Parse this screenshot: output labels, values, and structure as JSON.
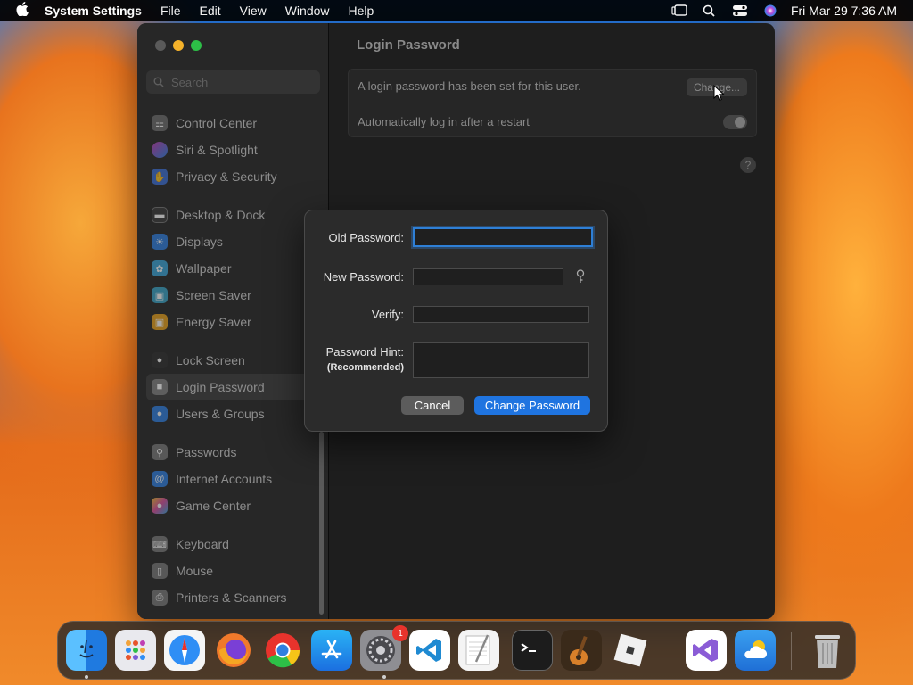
{
  "menubar": {
    "app_name": "System Settings",
    "menus": [
      "File",
      "Edit",
      "View",
      "Window",
      "Help"
    ],
    "clock": "Fri Mar 29  7:36 AM"
  },
  "sidebar": {
    "search_placeholder": "Search",
    "items": [
      {
        "label": "Control Center",
        "icon": "control-center-icon",
        "color": "#7a7a7a"
      },
      {
        "label": "Siri & Spotlight",
        "icon": "siri-icon",
        "color": "#c03fb3"
      },
      {
        "label": "Privacy & Security",
        "icon": "hand-icon",
        "color": "#3b6fd6"
      },
      {
        "label": "Desktop & Dock",
        "icon": "dock-icon",
        "color": "#2f2f2f"
      },
      {
        "label": "Displays",
        "icon": "sun-icon",
        "color": "#2f7fe0"
      },
      {
        "label": "Wallpaper",
        "icon": "flower-icon",
        "color": "#3aa5d8"
      },
      {
        "label": "Screen Saver",
        "icon": "screen-saver-icon",
        "color": "#3aa5c8"
      },
      {
        "label": "Energy Saver",
        "icon": "battery-icon",
        "color": "#e8a21c"
      },
      {
        "label": "Lock Screen",
        "icon": "lock-icon",
        "color": "#2f2f2f"
      },
      {
        "label": "Login Password",
        "icon": "login-password-icon",
        "color": "#7a7a7a"
      },
      {
        "label": "Users & Groups",
        "icon": "users-icon",
        "color": "#2f7fe0"
      },
      {
        "label": "Passwords",
        "icon": "key-icon",
        "color": "#7a7a7a"
      },
      {
        "label": "Internet Accounts",
        "icon": "at-icon",
        "color": "#2f7fe0"
      },
      {
        "label": "Game Center",
        "icon": "game-center-icon",
        "color": "#d84fa0"
      },
      {
        "label": "Keyboard",
        "icon": "keyboard-icon",
        "color": "#7a7a7a"
      },
      {
        "label": "Mouse",
        "icon": "mouse-icon",
        "color": "#7a7a7a"
      },
      {
        "label": "Printers & Scanners",
        "icon": "printer-icon",
        "color": "#7a7a7a"
      }
    ]
  },
  "content": {
    "title": "Login Password",
    "password_set_text": "A login password has been set for this user.",
    "change_button": "Change...",
    "auto_login_text": "Automatically log in after a restart",
    "auto_login_on": false,
    "help": "?"
  },
  "dialog": {
    "old_password_label": "Old Password:",
    "new_password_label": "New Password:",
    "verify_label": "Verify:",
    "hint_label": "Password Hint:",
    "hint_sub_label": "(Recommended)",
    "cancel_button": "Cancel",
    "change_button": "Change Password",
    "old_password_value": "",
    "new_password_value": "",
    "verify_value": "",
    "hint_value": ""
  },
  "dock": {
    "apps": [
      {
        "name": "Finder",
        "icon": "finder-icon",
        "color": "#2a8cf0",
        "running": true
      },
      {
        "name": "Launchpad",
        "icon": "launchpad-icon",
        "color": "#e9e9ee",
        "running": false
      },
      {
        "name": "Safari",
        "icon": "safari-icon",
        "color": "#2f8ef5",
        "running": false
      },
      {
        "name": "Firefox",
        "icon": "firefox-icon",
        "color": "#e8542c",
        "running": false
      },
      {
        "name": "Chrome",
        "icon": "chrome-icon",
        "color": "#ffffff",
        "running": false
      },
      {
        "name": "App Store",
        "icon": "app-store-icon",
        "color": "#1e8ef2",
        "running": false
      },
      {
        "name": "System Settings",
        "icon": "settings-icon",
        "color": "#8e8e93",
        "running": true,
        "badge": "1"
      },
      {
        "name": "Visual Studio Code",
        "icon": "vscode-icon",
        "color": "#ffffff",
        "running": false
      },
      {
        "name": "TextEdit",
        "icon": "textedit-icon",
        "color": "#f2f2f2",
        "running": false
      },
      {
        "name": "Terminal",
        "icon": "terminal-icon",
        "color": "#1c1c1c",
        "running": false
      },
      {
        "name": "GarageBand",
        "icon": "garageband-icon",
        "color": "#c86a1f",
        "running": false
      },
      {
        "name": "Roblox",
        "icon": "roblox-icon",
        "color": "#f0f0f0",
        "running": false
      },
      {
        "name": "Visual Studio",
        "icon": "visual-studio-icon",
        "color": "#ffffff",
        "running": false
      },
      {
        "name": "Weather",
        "icon": "weather-icon",
        "color": "#2f86e6",
        "running": false
      },
      {
        "name": "Trash",
        "icon": "trash-icon",
        "color": "#9a9a9a",
        "running": false
      }
    ]
  }
}
